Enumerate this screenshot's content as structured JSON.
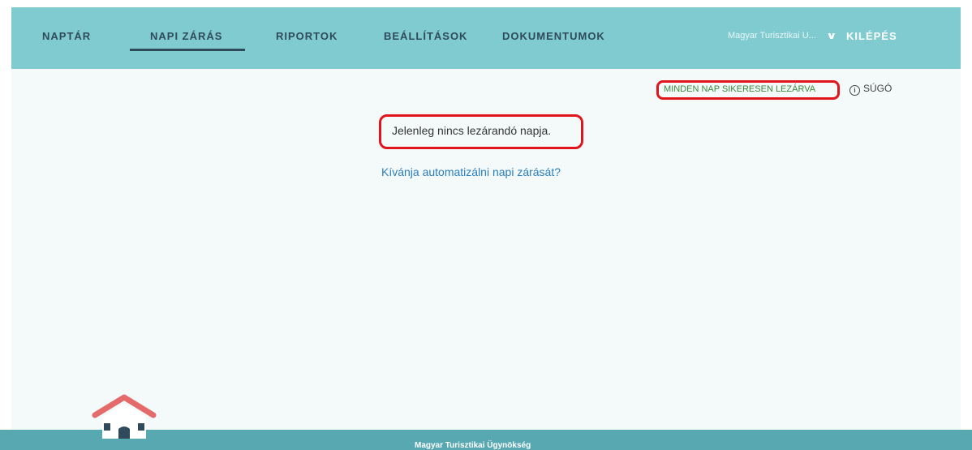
{
  "nav": {
    "items": [
      {
        "label": "NAPTÁR"
      },
      {
        "label": "NAPI ZÁRÁS",
        "active": true
      },
      {
        "label": "RIPORTOK"
      },
      {
        "label": "BEÁLLÍTÁSOK"
      },
      {
        "label": "DOKUMENTUMOK"
      }
    ],
    "account_name": "Magyar Turisztikai U...",
    "logout_label": "KILÉPÉS"
  },
  "main": {
    "status_text": "MINDEN NAP SIKERESEN LEZÁRVA",
    "help_label": "SÚGÓ",
    "message": "Jelenleg nincs lezárandó napja.",
    "automate_link": "Kívánja automatizálni napi zárását?"
  },
  "footer": {
    "text": "Magyar Turisztikai Ügynökség"
  },
  "colors": {
    "nav_bg": "#7fcbd0",
    "highlight": "#e0141a",
    "status_green": "#3a8a3a",
    "link_blue": "#2a7fbd",
    "footer_bg": "#58a8b2",
    "house_roof": "#e56b6b"
  },
  "icons": {
    "help": "info-icon",
    "account_dropdown": "chevron-down-icon",
    "home": "house-icon"
  }
}
